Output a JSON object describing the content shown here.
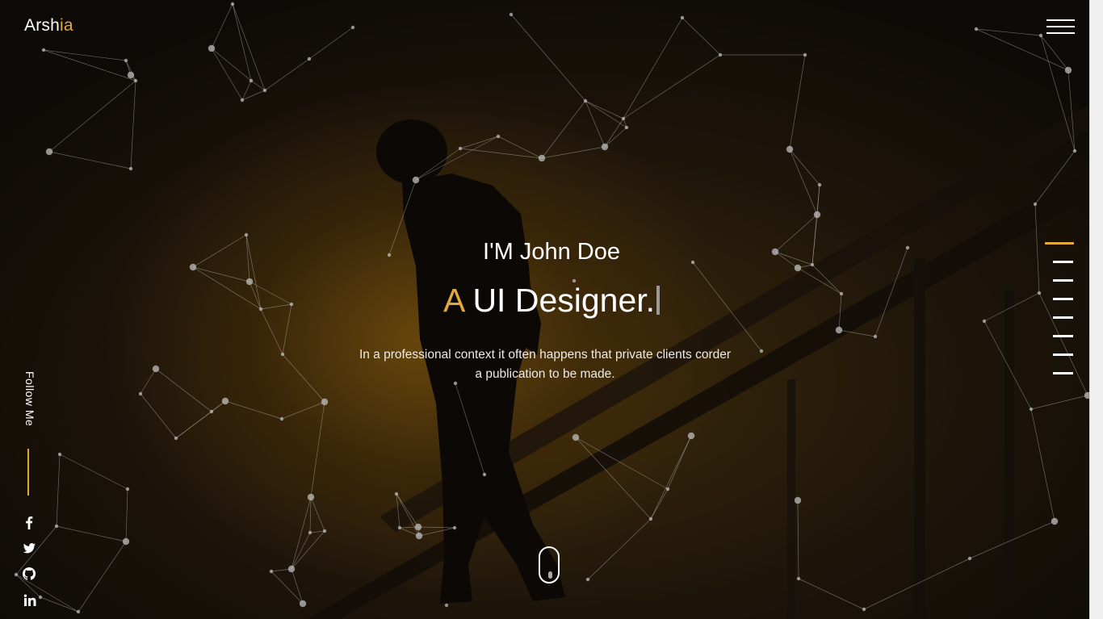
{
  "brand": {
    "prefix": "Arsh",
    "accent": "ia"
  },
  "hero": {
    "greeting": "I'M John Doe",
    "role_accent": "A",
    "role": "UI Designer.",
    "description_line1": "In a professional context it often happens that private clients corder",
    "description_line2": "a publication to be made."
  },
  "follow": {
    "label": "Follow Me"
  },
  "social": [
    {
      "icon": "facebook-icon"
    },
    {
      "icon": "twitter-icon"
    },
    {
      "icon": "github-icon"
    },
    {
      "icon": "linkedin-icon"
    }
  ],
  "side_nav": {
    "count": 8,
    "active_index": 0
  },
  "colors": {
    "accent": "#e2a93a",
    "text": "#ffffff",
    "background": "#0d0a07"
  }
}
